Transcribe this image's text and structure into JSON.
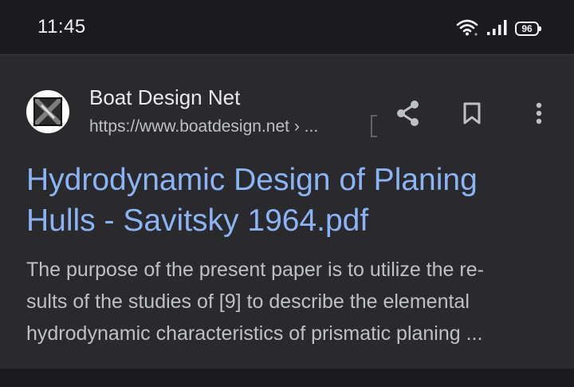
{
  "status_bar": {
    "time": "11:45",
    "battery": "96"
  },
  "result": {
    "site_name": "Boat Design Net",
    "url": "https://www.boatdesign.net › ...",
    "title_line1": "Hydrodynamic Design of Planing",
    "title_line2": "Hulls - Savitsky 1964.pdf",
    "snippet_line1": "The purpose of the present paper is to utilize the re-",
    "snippet_line2": "sults of the studies of [9] to describe the elemental",
    "snippet_line3": "hydrodynamic characteristics of prismatic planing ...",
    "favicon": "boat-design-net-logo",
    "actions": [
      "share-icon",
      "bookmark-icon",
      "more-vert-icon"
    ]
  },
  "colors": {
    "background": "#1b1b1d",
    "card": "#2a2a2d",
    "link": "#8ab4f8",
    "text": "#e8eaed",
    "secondary_text": "#bdc1c6"
  }
}
